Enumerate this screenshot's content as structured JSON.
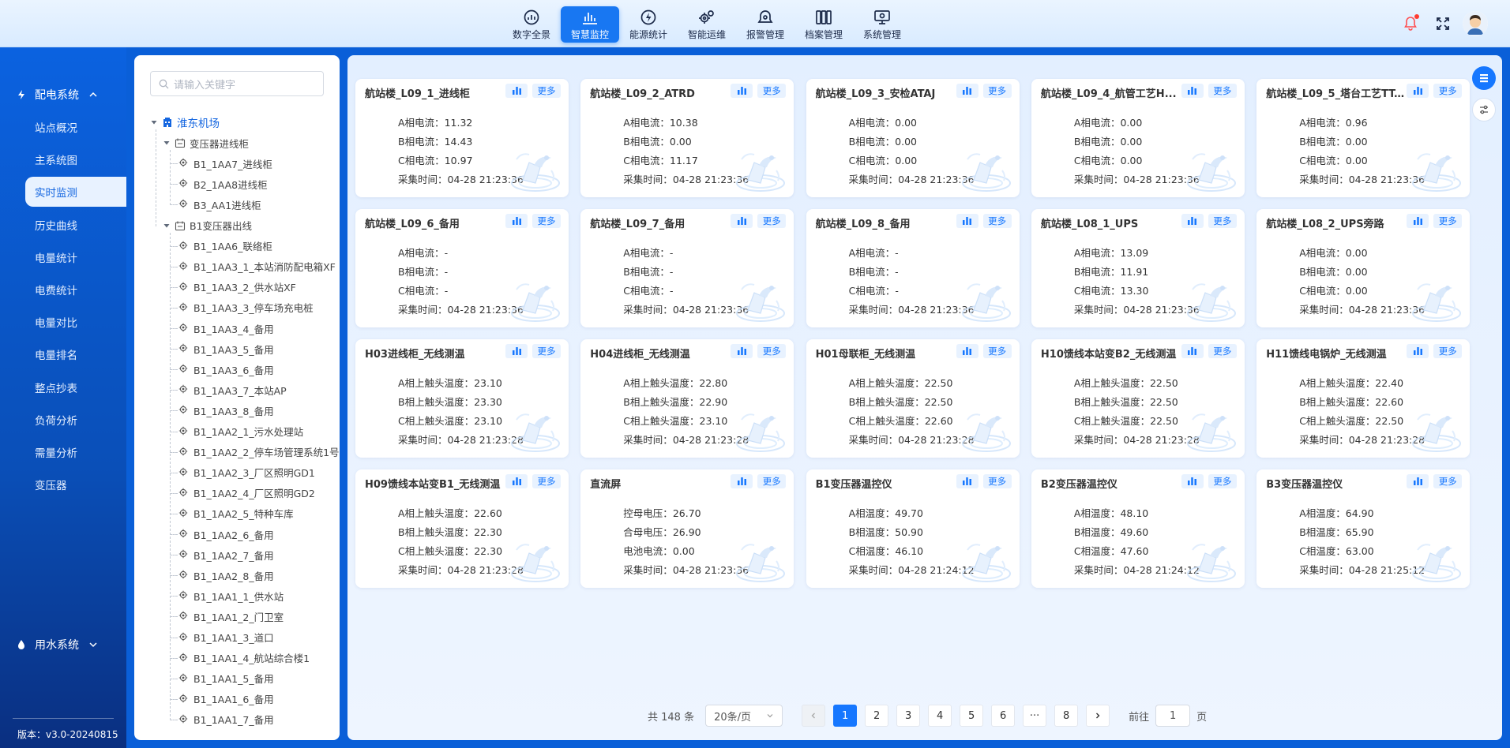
{
  "nav": {
    "items": [
      {
        "label": "数字全景",
        "icon": "dashboard-icon"
      },
      {
        "label": "智慧监控",
        "icon": "bar-chart-icon",
        "active": true
      },
      {
        "label": "能源统计",
        "icon": "lightning-icon"
      },
      {
        "label": "智能运维",
        "icon": "gears-icon"
      },
      {
        "label": "报警管理",
        "icon": "alarm-gear-icon"
      },
      {
        "label": "档案管理",
        "icon": "archive-icon"
      },
      {
        "label": "系统管理",
        "icon": "monitor-settings-icon"
      }
    ]
  },
  "sidebar": {
    "groups": [
      {
        "label": "配电系统",
        "icon": "lightning-icon",
        "expanded": true
      },
      {
        "label": "用水系统",
        "icon": "water-drop-icon",
        "expanded": false
      }
    ],
    "items": [
      "站点概况",
      "主系统图",
      "实时监测",
      "历史曲线",
      "电量统计",
      "电费统计",
      "电量对比",
      "电量排名",
      "整点抄表",
      "负荷分析",
      "需量分析",
      "变压器"
    ],
    "active_index": 2,
    "version": "版本：v3.0-20240815"
  },
  "tree": {
    "search_placeholder": "请输入关键字",
    "root": "淮东机场",
    "group1": "变压器进线柜",
    "group1_items": [
      "B1_1AA7_进线柜",
      "B2_1AA8进线柜",
      "B3_AA1进线柜"
    ],
    "group2": "B1变压器出线",
    "group2_items": [
      "B1_1AA6_联络柜",
      "B1_1AA3_1_本站消防配电箱XF",
      "B1_1AA3_2_供水站XF",
      "B1_1AA3_3_停车场充电桩",
      "B1_1AA3_4_备用",
      "B1_1AA3_5_备用",
      "B1_1AA3_6_备用",
      "B1_1AA3_7_本站AP",
      "B1_1AA3_8_备用",
      "B1_1AA2_1_污水处理站",
      "B1_1AA2_2_停车场管理系统1号",
      "B1_1AA2_3_厂区照明GD1",
      "B1_1AA2_4_厂区照明GD2",
      "B1_1AA2_5_特种车库",
      "B1_1AA2_6_备用",
      "B1_1AA2_7_备用",
      "B1_1AA2_8_备用",
      "B1_1AA1_1_供水站",
      "B1_1AA1_2_门卫室",
      "B1_1AA1_3_道口",
      "B1_1AA1_4_航站综合楼1",
      "B1_1AA1_5_备用",
      "B1_1AA1_6_备用",
      "B1_1AA1_7_备用"
    ]
  },
  "card_more_label": "更多",
  "cards": [
    {
      "title": "航站楼_L09_1_进线柜",
      "rows": [
        [
          "A相电流：",
          "11.32"
        ],
        [
          "B相电流：",
          "14.43"
        ],
        [
          "C相电流：",
          "10.97"
        ],
        [
          "采集时间：",
          "04-28 21:23:36"
        ]
      ]
    },
    {
      "title": "航站楼_L09_2_ATRD",
      "rows": [
        [
          "A相电流：",
          "10.38"
        ],
        [
          "B相电流：",
          "0.00"
        ],
        [
          "C相电流：",
          "11.17"
        ],
        [
          "采集时间：",
          "04-28 21:23:36"
        ]
      ]
    },
    {
      "title": "航站楼_L09_3_安检ATAJ",
      "rows": [
        [
          "A相电流：",
          "0.00"
        ],
        [
          "B相电流：",
          "0.00"
        ],
        [
          "C相电流：",
          "0.00"
        ],
        [
          "采集时间：",
          "04-28 21:23:36"
        ]
      ]
    },
    {
      "title": "航站楼_L09_4_航管工艺H...",
      "rows": [
        [
          "A相电流：",
          "0.00"
        ],
        [
          "B相电流：",
          "0.00"
        ],
        [
          "C相电流：",
          "0.00"
        ],
        [
          "采集时间：",
          "04-28 21:23:36"
        ]
      ]
    },
    {
      "title": "航站楼_L09_5_塔台工艺TT...",
      "rows": [
        [
          "A相电流：",
          "0.96"
        ],
        [
          "B相电流：",
          "0.00"
        ],
        [
          "C相电流：",
          "0.00"
        ],
        [
          "采集时间：",
          "04-28 21:23:36"
        ]
      ]
    },
    {
      "title": "航站楼_L09_6_备用",
      "rows": [
        [
          "A相电流：",
          "-"
        ],
        [
          "B相电流：",
          "-"
        ],
        [
          "C相电流：",
          "-"
        ],
        [
          "采集时间：",
          "04-28 21:23:36"
        ]
      ]
    },
    {
      "title": "航站楼_L09_7_备用",
      "rows": [
        [
          "A相电流：",
          "-"
        ],
        [
          "B相电流：",
          "-"
        ],
        [
          "C相电流：",
          "-"
        ],
        [
          "采集时间：",
          "04-28 21:23:36"
        ]
      ]
    },
    {
      "title": "航站楼_L09_8_备用",
      "rows": [
        [
          "A相电流：",
          "-"
        ],
        [
          "B相电流：",
          "-"
        ],
        [
          "C相电流：",
          "-"
        ],
        [
          "采集时间：",
          "04-28 21:23:36"
        ]
      ]
    },
    {
      "title": "航站楼_L08_1_UPS",
      "rows": [
        [
          "A相电流：",
          "13.09"
        ],
        [
          "B相电流：",
          "11.91"
        ],
        [
          "C相电流：",
          "13.30"
        ],
        [
          "采集时间：",
          "04-28 21:23:36"
        ]
      ]
    },
    {
      "title": "航站楼_L08_2_UPS旁路",
      "rows": [
        [
          "A相电流：",
          "0.00"
        ],
        [
          "B相电流：",
          "0.00"
        ],
        [
          "C相电流：",
          "0.00"
        ],
        [
          "采集时间：",
          "04-28 21:23:36"
        ]
      ]
    },
    {
      "title": "H03进线柜_无线测温",
      "rows": [
        [
          "A相上触头温度：",
          "23.10"
        ],
        [
          "B相上触头温度：",
          "23.30"
        ],
        [
          "C相上触头温度：",
          "23.10"
        ],
        [
          "采集时间：",
          "04-28 21:23:28"
        ]
      ]
    },
    {
      "title": "H04进线柜_无线测温",
      "rows": [
        [
          "A相上触头温度：",
          "22.80"
        ],
        [
          "B相上触头温度：",
          "22.90"
        ],
        [
          "C相上触头温度：",
          "23.10"
        ],
        [
          "采集时间：",
          "04-28 21:23:28"
        ]
      ]
    },
    {
      "title": "H01母联柜_无线测温",
      "rows": [
        [
          "A相上触头温度：",
          "22.50"
        ],
        [
          "B相上触头温度：",
          "22.50"
        ],
        [
          "C相上触头温度：",
          "22.60"
        ],
        [
          "采集时间：",
          "04-28 21:23:28"
        ]
      ]
    },
    {
      "title": "H10馈线本站变B2_无线测温",
      "rows": [
        [
          "A相上触头温度：",
          "22.50"
        ],
        [
          "B相上触头温度：",
          "22.50"
        ],
        [
          "C相上触头温度：",
          "22.50"
        ],
        [
          "采集时间：",
          "04-28 21:23:28"
        ]
      ]
    },
    {
      "title": "H11馈线电锅炉_无线测温",
      "rows": [
        [
          "A相上触头温度：",
          "22.40"
        ],
        [
          "B相上触头温度：",
          "22.60"
        ],
        [
          "C相上触头温度：",
          "22.50"
        ],
        [
          "采集时间：",
          "04-28 21:23:28"
        ]
      ]
    },
    {
      "title": "H09馈线本站变B1_无线测温",
      "rows": [
        [
          "A相上触头温度：",
          "22.60"
        ],
        [
          "B相上触头温度：",
          "22.30"
        ],
        [
          "C相上触头温度：",
          "22.30"
        ],
        [
          "采集时间：",
          "04-28 21:23:28"
        ]
      ]
    },
    {
      "title": "直流屏",
      "rows": [
        [
          "控母电压：",
          "26.70"
        ],
        [
          "合母电压：",
          "26.90"
        ],
        [
          "电池电流：",
          "0.00"
        ],
        [
          "采集时间：",
          "04-28 21:23:36"
        ]
      ]
    },
    {
      "title": "B1变压器温控仪",
      "rows": [
        [
          "A相温度：",
          "49.70"
        ],
        [
          "B相温度：",
          "50.90"
        ],
        [
          "C相温度：",
          "46.10"
        ],
        [
          "采集时间：",
          "04-28 21:24:12"
        ]
      ]
    },
    {
      "title": "B2变压器温控仪",
      "rows": [
        [
          "A相温度：",
          "48.10"
        ],
        [
          "B相温度：",
          "49.60"
        ],
        [
          "C相温度：",
          "47.60"
        ],
        [
          "采集时间：",
          "04-28 21:24:12"
        ]
      ]
    },
    {
      "title": "B3变压器温控仪",
      "rows": [
        [
          "A相温度：",
          "64.90"
        ],
        [
          "B相温度：",
          "65.90"
        ],
        [
          "C相温度：",
          "63.00"
        ],
        [
          "采集时间：",
          "04-28 21:25:12"
        ]
      ]
    }
  ],
  "pager": {
    "total": "共 148 条",
    "page_size": "20条/页",
    "pages": [
      "1",
      "2",
      "3",
      "4",
      "5",
      "6",
      "···",
      "8"
    ],
    "active": 0,
    "goto_prefix": "前往",
    "goto_value": "1",
    "goto_suffix": "页"
  },
  "colors": {
    "primary": "#1677ff",
    "sidebar": "#0b62e0",
    "main_bg": "#e3efff"
  }
}
